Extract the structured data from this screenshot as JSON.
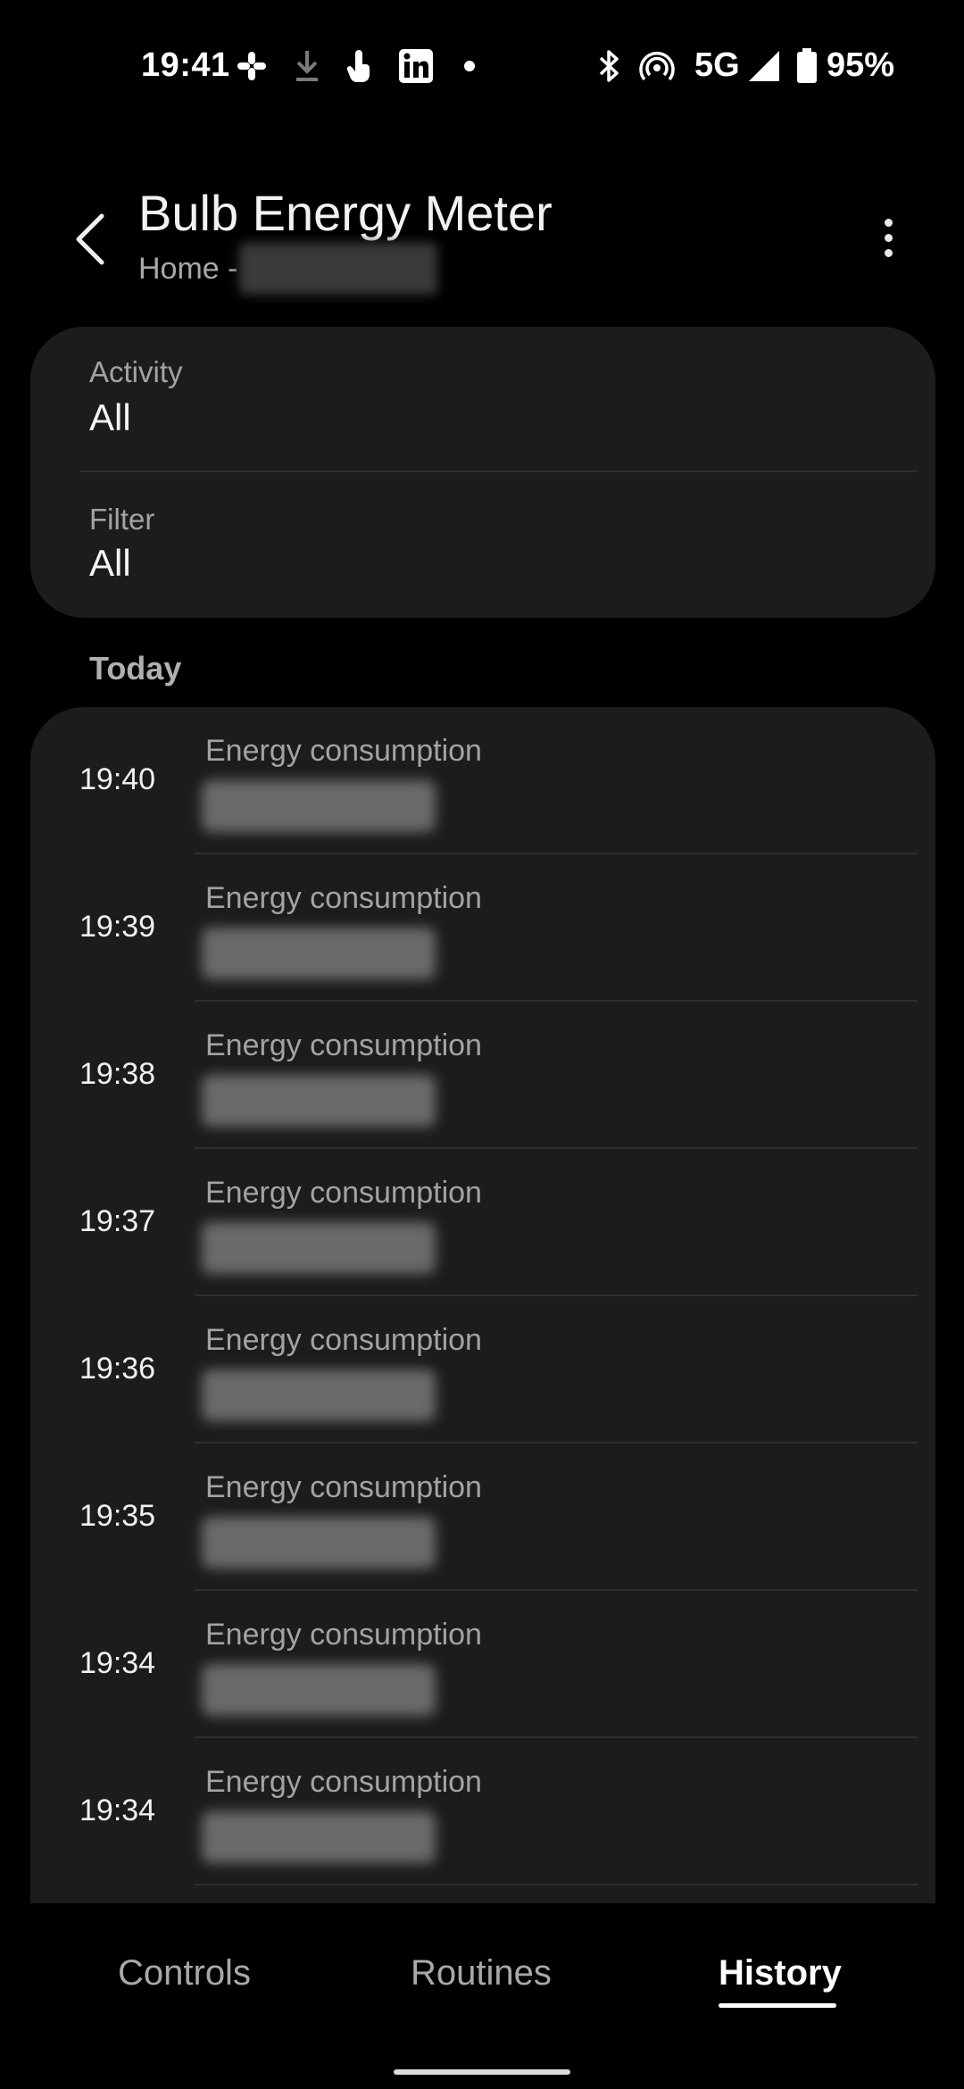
{
  "status_bar": {
    "time": "19:41",
    "network": "5G",
    "battery": "95%",
    "icons": [
      "slack-icon",
      "download-icon",
      "touch-icon",
      "linkedin-icon",
      "dot-icon",
      "bluetooth-icon",
      "hotspot-icon",
      "signal-icon",
      "battery-icon"
    ]
  },
  "header": {
    "title": "Bulb Energy Meter",
    "subtitle": "Home -"
  },
  "filters": {
    "activity_label": "Activity",
    "activity_value": "All",
    "filter_label": "Filter",
    "filter_value": "All"
  },
  "section": {
    "title": "Today"
  },
  "history": [
    {
      "time": "19:40",
      "label": "Energy consumption"
    },
    {
      "time": "19:39",
      "label": "Energy consumption"
    },
    {
      "time": "19:38",
      "label": "Energy consumption"
    },
    {
      "time": "19:37",
      "label": "Energy consumption"
    },
    {
      "time": "19:36",
      "label": "Energy consumption"
    },
    {
      "time": "19:35",
      "label": "Energy consumption"
    },
    {
      "time": "19:34",
      "label": "Energy consumption"
    },
    {
      "time": "19:34",
      "label": "Energy consumption"
    }
  ],
  "nav": {
    "tabs": [
      {
        "label": "Controls"
      },
      {
        "label": "Routines"
      },
      {
        "label": "History"
      }
    ],
    "active": "History"
  }
}
